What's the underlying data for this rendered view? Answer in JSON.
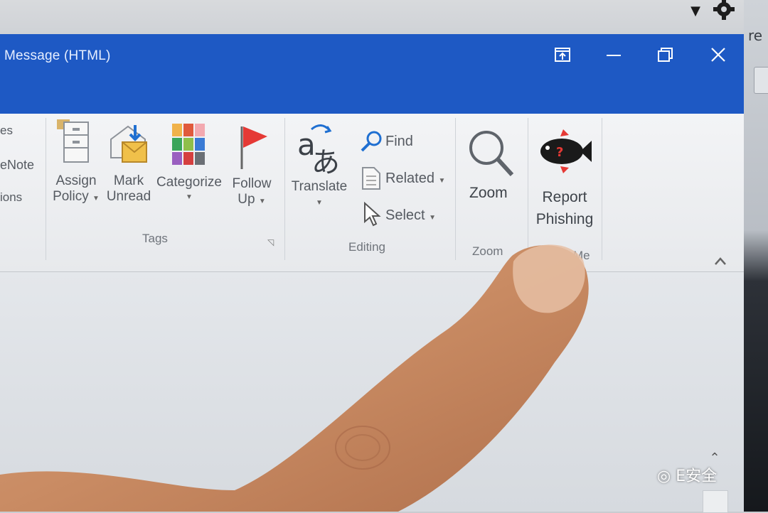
{
  "window": {
    "title": "Message (HTML)"
  },
  "ribbon_left_fragments": [
    "es",
    "eNote",
    "ions"
  ],
  "tags_group": {
    "label": "Tags",
    "buttons": [
      {
        "name": "assign-policy",
        "line1": "Assign",
        "line2": "Policy"
      },
      {
        "name": "mark-unread",
        "line1": "Mark",
        "line2": "Unread"
      },
      {
        "name": "categorize",
        "line1": "Categorize",
        "line2": ""
      },
      {
        "name": "follow-up",
        "line1": "Follow",
        "line2": "Up"
      }
    ]
  },
  "editing_group": {
    "label": "Editing",
    "translate": "Translate",
    "find": "Find",
    "related": "Related",
    "select": "Select"
  },
  "zoom_group": {
    "label": "Zoom",
    "button": "Zoom"
  },
  "report_group": {
    "label_fragment": "Me",
    "line1": "Report",
    "line2": "Phishing"
  },
  "right_edge_fragment": "re",
  "watermark": "E安全",
  "colors": {
    "titlebar": "#1e59c4",
    "ribbon_bg": "#f0f1f3",
    "flag_red": "#e53935"
  }
}
